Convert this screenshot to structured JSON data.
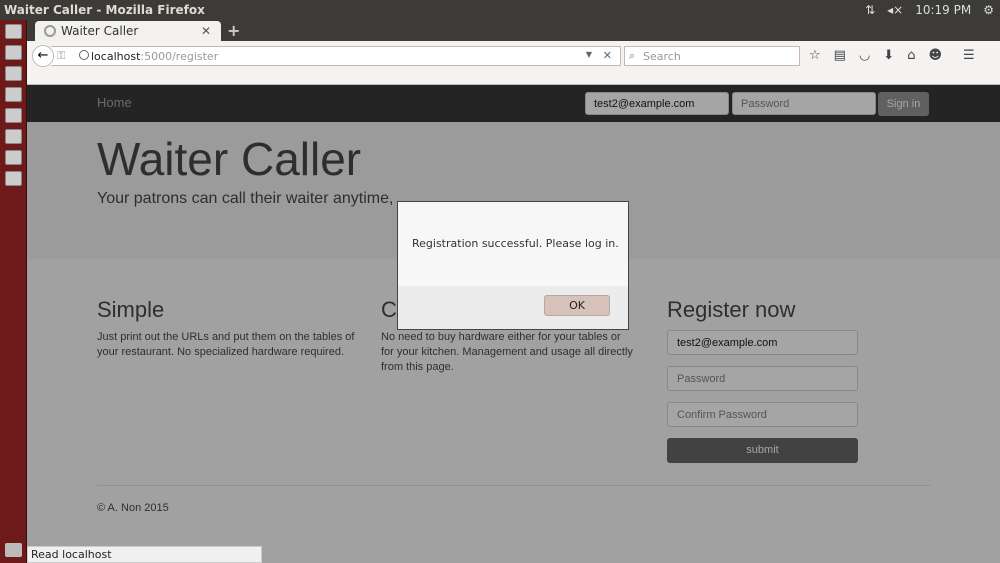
{
  "os": {
    "window_title": "Waiter Caller - Mozilla Firefox",
    "clock": "10:19 PM"
  },
  "browser": {
    "tab_title": "Waiter Caller",
    "url_host": "localhost",
    "url_path": ":5000/register",
    "search_placeholder": "Search",
    "status": "Read localhost"
  },
  "site": {
    "nav": {
      "home": "Home",
      "email_value": "test2@example.com",
      "password_placeholder": "Password",
      "signin": "Sign in"
    },
    "hero": {
      "title": "Waiter Caller",
      "subtitle": "Your patrons can call their waiter anytime,"
    },
    "columns": [
      {
        "heading": "Simple",
        "text": "Just print out the URLs and put them on the tables of your restaurant. No specialized hardware required."
      },
      {
        "heading": "C",
        "text": "No need to buy hardware either for your tables or for your kitchen. Management and usage all directly from this page."
      }
    ],
    "register": {
      "heading": "Register now",
      "email_value": "test2@example.com",
      "password_placeholder": "Password",
      "confirm_placeholder": "Confirm Password",
      "submit": "submit"
    },
    "footer": "© A. Non 2015"
  },
  "dialog": {
    "message": "Registration successful. Please log in.",
    "ok": "OK"
  }
}
